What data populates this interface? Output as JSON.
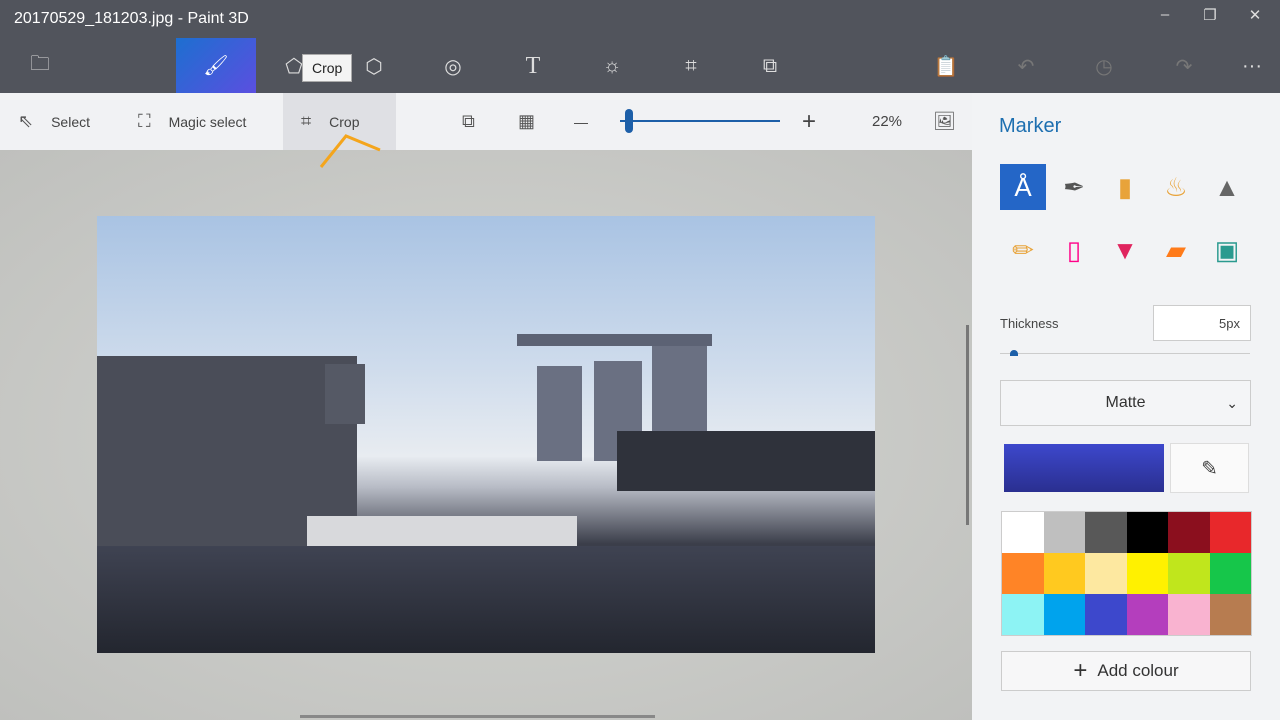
{
  "window": {
    "title": "20170529_181203.jpg - Paint 3D",
    "minimize": "–",
    "restore": "❐",
    "close": "✕"
  },
  "toolbar": {
    "tooltip": "Crop",
    "more": "···"
  },
  "subtoolbar": {
    "select": "Select",
    "magic_select": "Magic select",
    "crop": "Crop",
    "zoom": "22%",
    "zoom_minus": "—",
    "zoom_plus": "+",
    "zoom_level_percent": 22
  },
  "panel": {
    "title": "Marker",
    "brushes": [
      "marker",
      "calligraphy-pen",
      "oil-brush",
      "watercolor",
      "pixel-pen",
      "pencil",
      "eraser",
      "crayon",
      "spray-can",
      "fill"
    ],
    "thickness_label": "Thickness",
    "thickness_value": "5px",
    "finish": "Matte",
    "chevron": "⌄",
    "current_colour": "#3d48cc",
    "palette": [
      "#ffffff",
      "#bfbfbf",
      "#585858",
      "#000000",
      "#8b0f1e",
      "#e8282b",
      "#ff8426",
      "#ffc91f",
      "#fde8a0",
      "#fff100",
      "#c0e61c",
      "#16c64a",
      "#8df3f4",
      "#00a3ed",
      "#3d48cc",
      "#b43ebd",
      "#f9b3d0",
      "#b77c50"
    ],
    "add_colour": "Add colour",
    "add_icon": "+"
  }
}
